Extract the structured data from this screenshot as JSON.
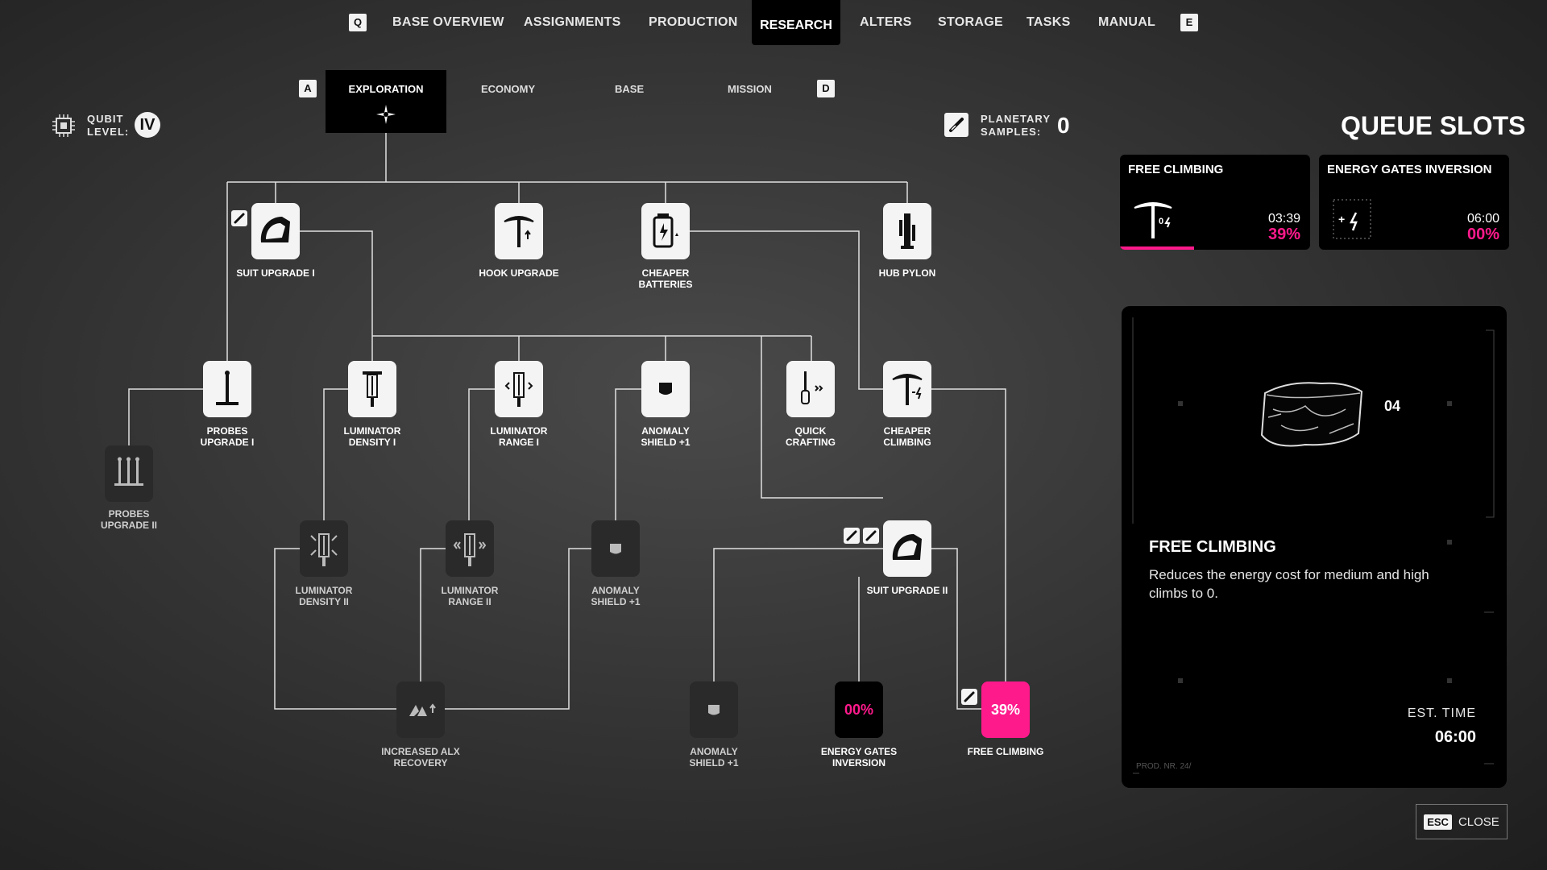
{
  "nav": {
    "key_left": "Q",
    "key_right": "E",
    "items": [
      "BASE OVERVIEW",
      "ASSIGNMENTS",
      "PRODUCTION",
      "RESEARCH",
      "ALTERS",
      "STORAGE",
      "TASKS",
      "MANUAL"
    ],
    "active": "RESEARCH"
  },
  "subtabs": {
    "key_left": "A",
    "key_right": "D",
    "items": [
      "EXPLORATION",
      "ECONOMY",
      "BASE",
      "MISSION"
    ],
    "active": "EXPLORATION"
  },
  "qubit": {
    "label_line1": "QUBIT",
    "label_line2": "LEVEL:",
    "level": "IV"
  },
  "samples": {
    "label_line1": "PLANETARY",
    "label_line2": "SAMPLES:",
    "value": "0"
  },
  "tree": {
    "suit_upgrade_1": "SUIT UPGRADE I",
    "hook_upgrade": "HOOK UPGRADE",
    "cheaper_batteries_1": "CHEAPER",
    "cheaper_batteries_2": "BATTERIES",
    "hub_pylon": "HUB PYLON",
    "probes_upgrade_1_a": "PROBES",
    "probes_upgrade_1_b": "UPGRADE I",
    "luminator_density_1_a": "LUMINATOR",
    "luminator_density_1_b": "DENSITY I",
    "luminator_range_1_a": "LUMINATOR",
    "luminator_range_1_b": "RANGE I",
    "anomaly_shield_1_a": "ANOMALY",
    "anomaly_shield_1_b": "SHIELD +1",
    "quick_crafting_a": "QUICK",
    "quick_crafting_b": "CRAFTING",
    "cheaper_climbing_a": "CHEAPER",
    "cheaper_climbing_b": "CLIMBING",
    "probes_upgrade_2_a": "PROBES",
    "probes_upgrade_2_b": "UPGRADE II",
    "luminator_density_2_a": "LUMINATOR",
    "luminator_density_2_b": "DENSITY II",
    "luminator_range_2_a": "LUMINATOR",
    "luminator_range_2_b": "RANGE II",
    "anomaly_shield_2_a": "ANOMALY",
    "anomaly_shield_2_b": "SHIELD +1",
    "suit_upgrade_2": "SUIT UPGRADE II",
    "increased_alx_a": "INCREASED ALX",
    "increased_alx_b": "RECOVERY",
    "anomaly_shield_3_a": "ANOMALY",
    "anomaly_shield_3_b": "SHIELD +1",
    "energy_gates_a": "ENERGY GATES",
    "energy_gates_b": "INVERSION",
    "energy_gates_pct": "00%",
    "free_climbing": "FREE CLIMBING",
    "free_climbing_pct": "39%"
  },
  "queue": {
    "title": "QUEUE SLOTS",
    "slots": [
      {
        "name": "FREE CLIMBING",
        "time": "03:39",
        "percent": "39%",
        "progress": 0.39
      },
      {
        "name": "ENERGY GATES INVERSION",
        "time": "06:00",
        "percent": "00%",
        "progress": 0
      }
    ]
  },
  "detail": {
    "title": "FREE CLIMBING",
    "description": "Reduces the energy cost for medium and high climbs to 0.",
    "est_label": "EST. TIME",
    "est_value": "06:00",
    "badge": "04",
    "prod_label": "PROD. NR. 24/"
  },
  "close": {
    "key": "ESC",
    "label": "CLOSE"
  },
  "colors": {
    "accent": "#ff1a8c",
    "panel": "#000000",
    "node": "#f4f4f4"
  }
}
